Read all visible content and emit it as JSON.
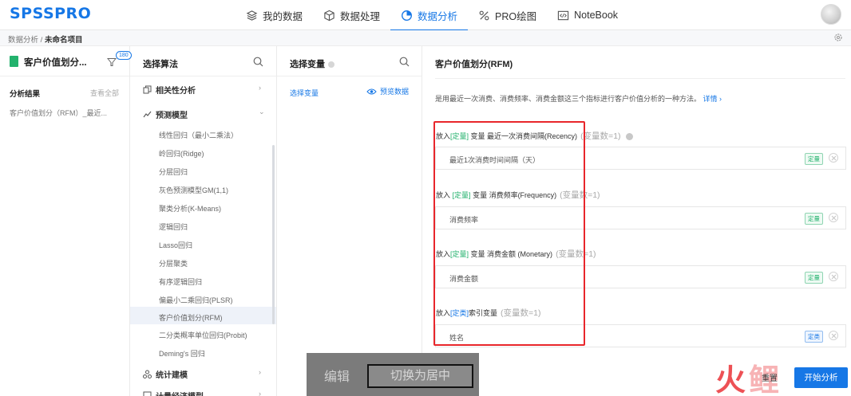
{
  "app": {
    "logo": "SPSSPRO"
  },
  "nav": {
    "items": [
      {
        "label": "我的数据",
        "icon": "layers-icon"
      },
      {
        "label": "数据处理",
        "icon": "cube-icon"
      },
      {
        "label": "数据分析",
        "icon": "pie-chart-icon",
        "active": true
      },
      {
        "label": "PRO绘图",
        "icon": "percent-icon"
      },
      {
        "label": "NoteBook",
        "icon": "code-icon"
      }
    ],
    "accent": "#1677e6"
  },
  "breadcrumb": {
    "parent": "数据分析",
    "sep": " / ",
    "current": "未命名项目"
  },
  "project_panel": {
    "title": "客户价值划分...",
    "badge": "180",
    "results_label": "分析结果",
    "view_all": "查看全部",
    "result_item": "客户价值划分（RFM）_最近..."
  },
  "algo_panel": {
    "title": "选择算法",
    "categories": [
      {
        "label": "相关性分析",
        "arrow": "›"
      },
      {
        "label": "预测模型",
        "arrow": "⌄"
      },
      {
        "label": "统计建模",
        "arrow": "›"
      },
      {
        "label": "计量经济模型",
        "arrow": "›"
      }
    ],
    "algorithms": [
      "线性回归（最小二乘法）",
      "岭回归(Ridge)",
      "分层回归",
      "灰色预测模型GM(1,1)",
      "聚类分析(K-Means)",
      "逻辑回归",
      "Lasso回归",
      "分层聚类",
      "有序逻辑回归",
      "偏最小二乘回归(PLSR)",
      "客户价值划分(RFM)",
      "二分类概率单位回归(Probit)",
      "Deming's 回归"
    ],
    "selected_index": 10
  },
  "var_panel": {
    "title": "选择变量",
    "select_label": "选择变量",
    "preview_label": "预览数据"
  },
  "config": {
    "title": "客户价值划分(RFM)",
    "description": "是用最近一次消费、消费频率、消费金额这三个指标进行客户价值分析的一种方法。",
    "detail_link": "详情 ›",
    "sections": [
      {
        "prefix": "放入",
        "tag": "[定量]",
        "label": "变量 最近一次消费间隔(Recency)",
        "count": "(变量数=1)",
        "help": true,
        "var": "最近1次消费时间间隔（天）",
        "var_tag": "定量"
      },
      {
        "prefix": "放入",
        "tag": "[定量]",
        "label": "变量 消费频率(Frequency)",
        "count": "(变量数=1)",
        "help": false,
        "var": "消费频率",
        "var_tag": "定量"
      },
      {
        "prefix": "放入",
        "tag": "[定量]",
        "label": "变量 消费金额 (Monetary)",
        "count": "(变量数=1)",
        "help": false,
        "var": "消费金额",
        "var_tag": "定量"
      },
      {
        "prefix": "放入",
        "tag": "[定类]",
        "label": "索引变量",
        "count": "(变量数=1)",
        "help": false,
        "var": "姓名",
        "var_tag": "定类"
      }
    ]
  },
  "overlay": {
    "edit_label": "编辑",
    "switch_label": "切换为居中"
  },
  "footer": {
    "reset_label": "重置",
    "start_label": "开始分析"
  },
  "watermark": {
    "text": "火鲤"
  },
  "colors": {
    "highlight_red": "#e8262b",
    "green_tag": "#23b26d",
    "accent": "#1677e6"
  }
}
